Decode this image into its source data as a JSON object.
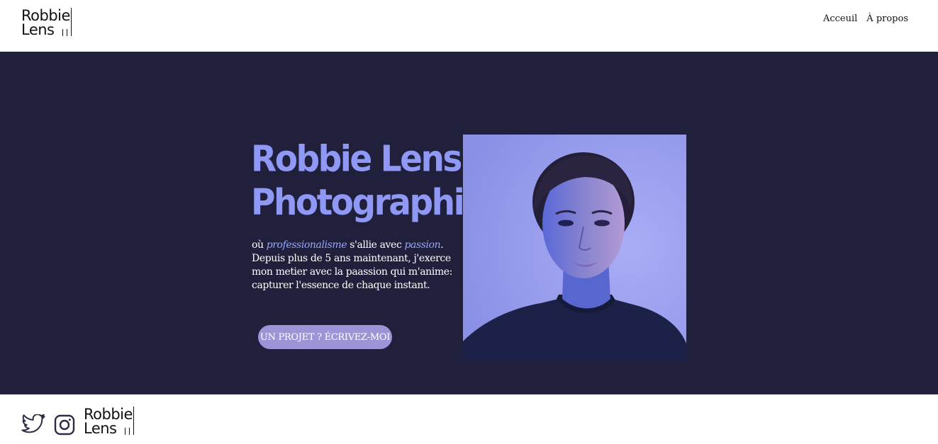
{
  "header": {
    "logo_line1": "Robbie",
    "logo_line2": "Lens",
    "nav": [
      {
        "label": "Acceuil"
      },
      {
        "label": "À propos"
      }
    ]
  },
  "hero": {
    "title_line1": "Robbie Lens",
    "title_line2": "Photographie",
    "tagline": {
      "prefix": "où ",
      "emph1": "professionalisme",
      "middle": " s'allie avec ",
      "emph2": "passion",
      "suffix": ". Depuis plus de 5 ans maintenant, j'exerce mon metier avec la paassion qui m'anime: capturer l'essence de chaque instant."
    },
    "cta_label": "UN PROJET ? ÉCRIVEZ-MOI",
    "portrait_icon": "portrait-photo"
  },
  "footer": {
    "logo_line1": "Robbie",
    "logo_line2": "Lens",
    "social": [
      {
        "icon": "twitter-icon"
      },
      {
        "icon": "instagram-icon"
      }
    ]
  },
  "colors": {
    "hero_bg": "#20203c",
    "accent": "#8f98f5",
    "button": "#9b95d8"
  }
}
